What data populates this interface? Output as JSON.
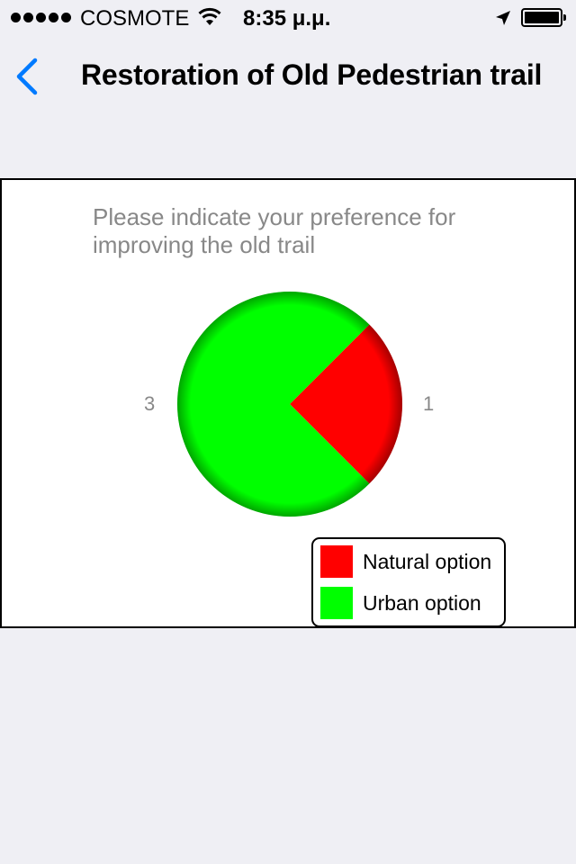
{
  "status_bar": {
    "carrier": "COSMOTE",
    "time": "8:35 μ.μ.",
    "icons": [
      "signal-dots-icon",
      "wifi-icon",
      "location-arrow-icon",
      "battery-icon"
    ]
  },
  "nav": {
    "back_icon": "chevron-left-icon",
    "title": "Restoration of Old Pedestrian trail",
    "accent_color": "#007aff"
  },
  "chart_data": {
    "type": "pie",
    "title": "Please indicate your preference for improving the old trail",
    "series": [
      {
        "name": "Natural option",
        "value": 1,
        "color": "#ff0000"
      },
      {
        "name": "Urban option",
        "value": 3,
        "color": "#00ff00"
      }
    ],
    "data_labels": [
      "3",
      "1"
    ],
    "legend_position": "bottom-right"
  }
}
